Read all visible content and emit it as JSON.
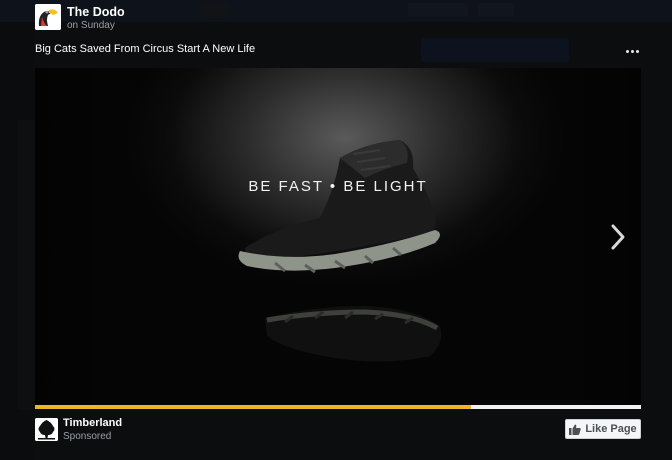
{
  "post": {
    "page_name": "The Dodo",
    "time": "on Sunday",
    "caption": "Big Cats Saved From Circus Start A New Life"
  },
  "video": {
    "headline": "BE FAST • BE LIGHT",
    "progress": 0.72
  },
  "sponsor": {
    "name": "Timberland",
    "label": "Sponsored",
    "like_label": "Like Page"
  },
  "colors": {
    "progress_fill": "#f0b429",
    "progress_track": "#f2f2f2",
    "background": "#1f2124"
  },
  "icons": {
    "page_avatar": "dodo-bird-icon",
    "sponsor_avatar": "timberland-tree-icon",
    "more": "more-dots-icon",
    "next": "chevron-right-icon",
    "like": "thumbs-up-icon"
  }
}
